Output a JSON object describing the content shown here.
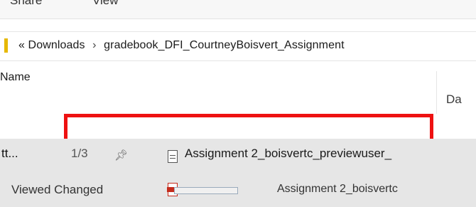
{
  "ribbon": {
    "tabs": [
      "Share",
      "View"
    ]
  },
  "address_bar": {
    "overflow_glyph": "«",
    "segments": [
      "Downloads",
      "gradebook_DFI_CourtneyBoisvert_Assignment"
    ],
    "separator": "›"
  },
  "columns": {
    "name": "Name",
    "date": "Da"
  },
  "recent_popup": {
    "row1": {
      "left_text": "tt...",
      "center_text": "1/3",
      "item_label": "Assignment 2_boisvertc_previewuser_"
    },
    "row2": {
      "left_text": "Viewed Changed",
      "item_label": "Assignment 2_boisvertc"
    }
  },
  "colors": {
    "highlight": "#ee1111",
    "popup_bg": "#e6e6e6",
    "folder": "#e6b800"
  }
}
